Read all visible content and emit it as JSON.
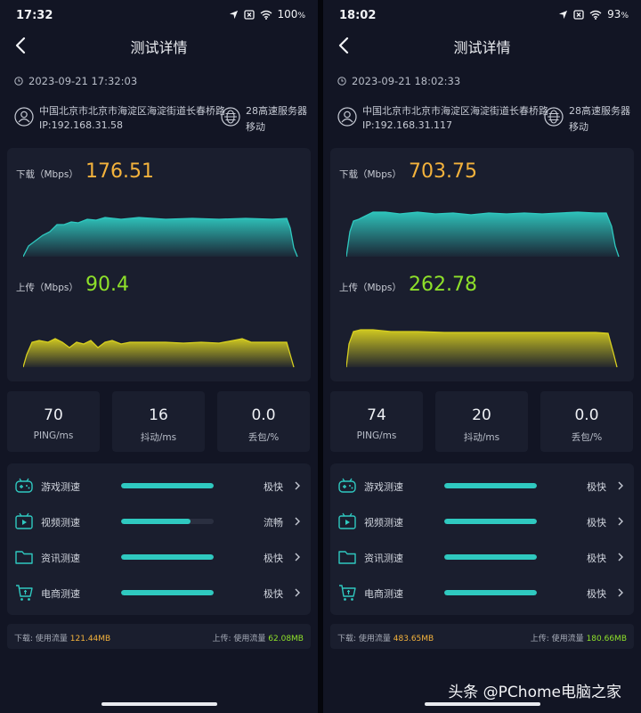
{
  "screens": [
    {
      "status": {
        "time": "17:32",
        "battery": "100"
      },
      "nav": {
        "title": "测试详情"
      },
      "datetime": "2023-09-21 17:32:03",
      "location": {
        "address": "中国北京市北京市海淀区海淀街道长春桥路",
        "ip": "IP:192.168.31.58"
      },
      "server": {
        "name": "28高速服务器",
        "isp": "移动"
      },
      "download": {
        "label": "下载（Mbps）",
        "value": "176.51"
      },
      "upload": {
        "label": "上传（Mbps）",
        "value": "90.4"
      },
      "stats": [
        {
          "value": "70",
          "label": "PING/ms"
        },
        {
          "value": "16",
          "label": "抖动/ms"
        },
        {
          "value": "0.0",
          "label": "丢包/%"
        }
      ],
      "tests": [
        {
          "name": "游戏测速",
          "status": "极快",
          "level": 1.0,
          "icon": "gamepad-icon"
        },
        {
          "name": "视频测速",
          "status": "流畅",
          "level": 0.75,
          "icon": "video-icon"
        },
        {
          "name": "资讯测速",
          "status": "极快",
          "level": 1.0,
          "icon": "folder-icon"
        },
        {
          "name": "电商测速",
          "status": "极快",
          "level": 1.0,
          "icon": "cart-icon"
        }
      ],
      "traffic": {
        "down_label": "下载:  使用流量",
        "down_value": "121.44MB",
        "up_label": "上传:  使用流量",
        "up_value": "62.08MB"
      }
    },
    {
      "status": {
        "time": "18:02",
        "battery": "93"
      },
      "nav": {
        "title": "测试详情"
      },
      "datetime": "2023-09-21 18:02:33",
      "location": {
        "address": "中国北京市北京市海淀区海淀街道长春桥路",
        "ip": "IP:192.168.31.117"
      },
      "server": {
        "name": "28高速服务器",
        "isp": "移动"
      },
      "download": {
        "label": "下载（Mbps）",
        "value": "703.75"
      },
      "upload": {
        "label": "上传（Mbps）",
        "value": "262.78"
      },
      "stats": [
        {
          "value": "74",
          "label": "PING/ms"
        },
        {
          "value": "20",
          "label": "抖动/ms"
        },
        {
          "value": "0.0",
          "label": "丢包/%"
        }
      ],
      "tests": [
        {
          "name": "游戏测速",
          "status": "极快",
          "level": 1.0,
          "icon": "gamepad-icon"
        },
        {
          "name": "视频测速",
          "status": "极快",
          "level": 1.0,
          "icon": "video-icon"
        },
        {
          "name": "资讯测速",
          "status": "极快",
          "level": 1.0,
          "icon": "folder-icon"
        },
        {
          "name": "电商测速",
          "status": "极快",
          "level": 1.0,
          "icon": "cart-icon"
        }
      ],
      "traffic": {
        "down_label": "下载:  使用流量",
        "down_value": "483.65MB",
        "up_label": "上传:  使用流量",
        "up_value": "180.66MB"
      }
    }
  ],
  "colors": {
    "download_accent": "#f3b23c",
    "upload_accent": "#8ee02a",
    "download_wave": "#2fc9c0",
    "upload_wave": "#d8d020",
    "progress": "#2fc9c0"
  },
  "watermark": "头条 @PChome电脑之家"
}
